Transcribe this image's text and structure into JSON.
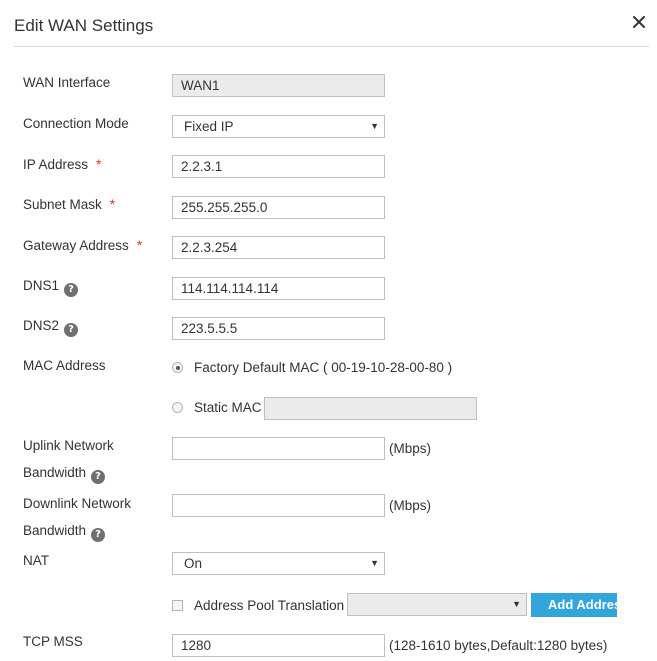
{
  "dialog": {
    "title": "Edit WAN Settings",
    "close_icon": "close-icon"
  },
  "form": {
    "wan_interface": {
      "label": "WAN Interface",
      "value": "WAN1"
    },
    "connection_mode": {
      "label": "Connection Mode",
      "value": "Fixed IP"
    },
    "ip_address": {
      "label": "IP Address",
      "required_mark": "*",
      "value": "2.2.3.1"
    },
    "subnet_mask": {
      "label": "Subnet Mask",
      "required_mark": "*",
      "value": "255.255.255.0"
    },
    "gateway_address": {
      "label": "Gateway Address",
      "required_mark": "*",
      "value": "2.2.3.254"
    },
    "dns1": {
      "label": "DNS1",
      "help_icon": "?",
      "value": "114.114.114.114"
    },
    "dns2": {
      "label": "DNS2",
      "help_icon": "?",
      "value": "223.5.5.5"
    },
    "mac_address": {
      "label": "MAC Address",
      "factory_default_label": "Factory Default MAC ( 00-19-10-28-00-80 )",
      "factory_default_selected": true,
      "static_mac_label": "Static MAC",
      "static_mac_value": ""
    },
    "uplink_bandwidth": {
      "label_line1": "Uplink Network",
      "label_line2": "Bandwidth",
      "help_icon": "?",
      "value": "",
      "unit": "(Mbps)"
    },
    "downlink_bandwidth": {
      "label_line1": "Downlink Network",
      "label_line2": "Bandwidth",
      "help_icon": "?",
      "value": "",
      "unit": "(Mbps)"
    },
    "nat": {
      "label": "NAT",
      "value": "On"
    },
    "address_pool": {
      "label": "Address Pool Translation",
      "checked": false,
      "select_value": "",
      "add_button_label": "Add Address"
    },
    "tcp_mss": {
      "label": "TCP MSS",
      "value": "1280",
      "hint": "(128-1610 bytes,Default:1280 bytes)"
    }
  },
  "colors": {
    "required_mark": "#e0301e",
    "add_button_bg": "#31a5dc",
    "help_icon_bg": "#6f6f6f",
    "disabled_input_bg": "#ebebeb"
  }
}
